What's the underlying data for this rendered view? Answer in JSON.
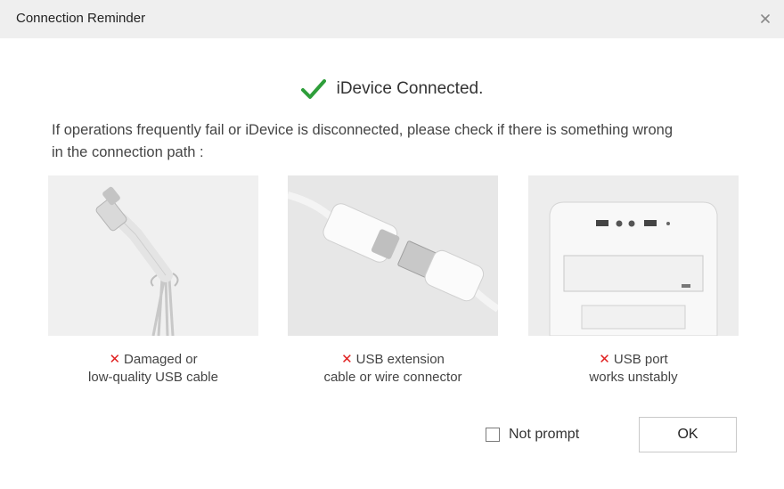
{
  "window": {
    "title": "Connection Reminder",
    "close_icon": "close-icon"
  },
  "status": {
    "icon": "checkmark-icon",
    "icon_color": "#2e9e3a",
    "text": "iDevice Connected."
  },
  "message": {
    "line1": "If operations frequently fail or iDevice is disconnected, please check if there is something wrong",
    "line2": "in the connection path :"
  },
  "cards": [
    {
      "image": "damaged-cable-image",
      "error_icon": "x-icon",
      "caption_line1": "Damaged or",
      "caption_line2": "low-quality USB cable"
    },
    {
      "image": "usb-extension-image",
      "error_icon": "x-icon",
      "caption_line1": "USB extension",
      "caption_line2": "cable or wire connector"
    },
    {
      "image": "usb-port-image",
      "error_icon": "x-icon",
      "caption_line1": "USB port",
      "caption_line2": "works unstably"
    }
  ],
  "error_color": "#e02020",
  "footer": {
    "checkbox_label": "Not prompt",
    "checkbox_checked": false,
    "ok_label": "OK"
  }
}
